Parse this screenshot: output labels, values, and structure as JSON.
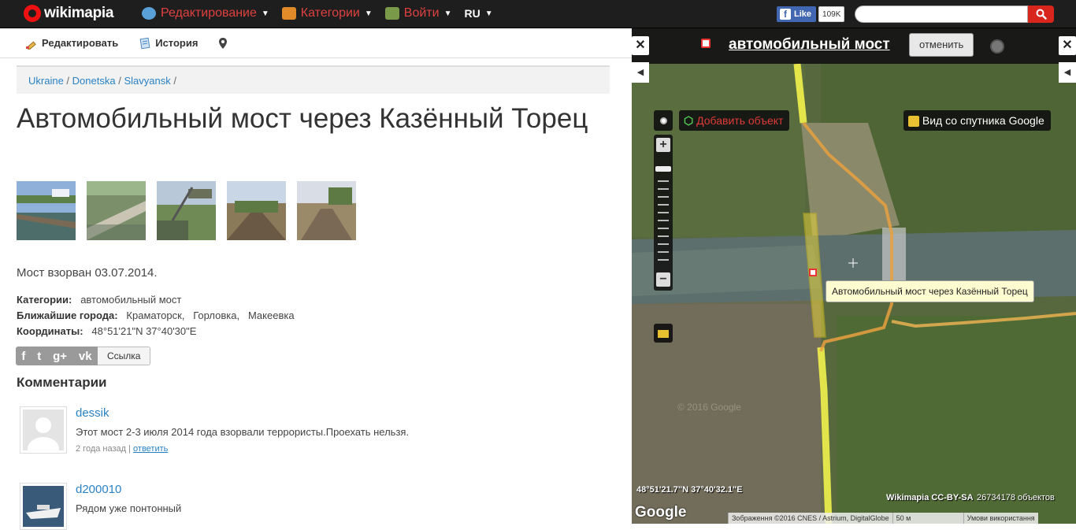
{
  "topbar": {
    "brand": "wikimapia",
    "nav": [
      {
        "label": "Редактирование",
        "icon": "globe-edit-icon",
        "icon_color": "#5aa0d8"
      },
      {
        "label": "Категории",
        "icon": "categories-icon",
        "icon_color": "#e08a2a"
      },
      {
        "label": "Войти",
        "icon": "login-icon",
        "icon_color": "#7a9a4a"
      }
    ],
    "lang": "RU",
    "fb_like": "Like",
    "fb_count": "109K",
    "search_placeholder": ""
  },
  "toolbar": {
    "edit": "Редактировать",
    "history": "История"
  },
  "breadcrumb": [
    "Ukraine",
    "Donetska",
    "Slavyansk"
  ],
  "breadcrumb_sep": "/",
  "place": {
    "title": "Автомобильный мост через Казённый Торец",
    "description": "Мост взорван 03.07.2014.",
    "categories_label": "Категории:",
    "categories_value": "автомобильный мост",
    "nearby_label": "Ближайшие города:",
    "nearby_value": "Краматорск,   Горловка,   Макеевка",
    "coords_label": "Координаты:",
    "coords_value": "48°51'21\"N 37°40'30\"E"
  },
  "share": {
    "icons": [
      "f",
      "t",
      "g+",
      "vk"
    ],
    "link_label": "Ссылка"
  },
  "comments": {
    "heading": "Комментарии",
    "items": [
      {
        "user": "dessik",
        "text": "Этот мост 2-3 июля 2014 года взорвали террористы.Проехать нельзя.",
        "age": "2 года назад",
        "reply": "ответить"
      },
      {
        "user": "d200010",
        "text": "Рядом уже понтонный",
        "age": "",
        "reply": ""
      }
    ]
  },
  "map": {
    "title": "автомобильный мост",
    "cancel": "отменить",
    "add_object": "Добавить объект",
    "satellite": "Вид со спутника Google",
    "tooltip": "Автомобильный мост через Казённый Торец",
    "coord_readout": "48°51'21.7\"N 37°40'32.1\"E",
    "google": "Google",
    "attribution": "Wikimapia CC-BY-SA",
    "object_count": "26734178 объектов",
    "watermark": "© 2016 Google",
    "footer": [
      "Зображення ©2016 CNES / Astrium, DigitalGlobe",
      "50 м",
      "Умови використання"
    ]
  },
  "colors": {
    "accent_red": "#d9261c",
    "link_blue": "#2a82c4",
    "topbar_bg": "#1e1e1e",
    "road_yellow": "#f0f050",
    "route_orange": "#e8a040"
  }
}
